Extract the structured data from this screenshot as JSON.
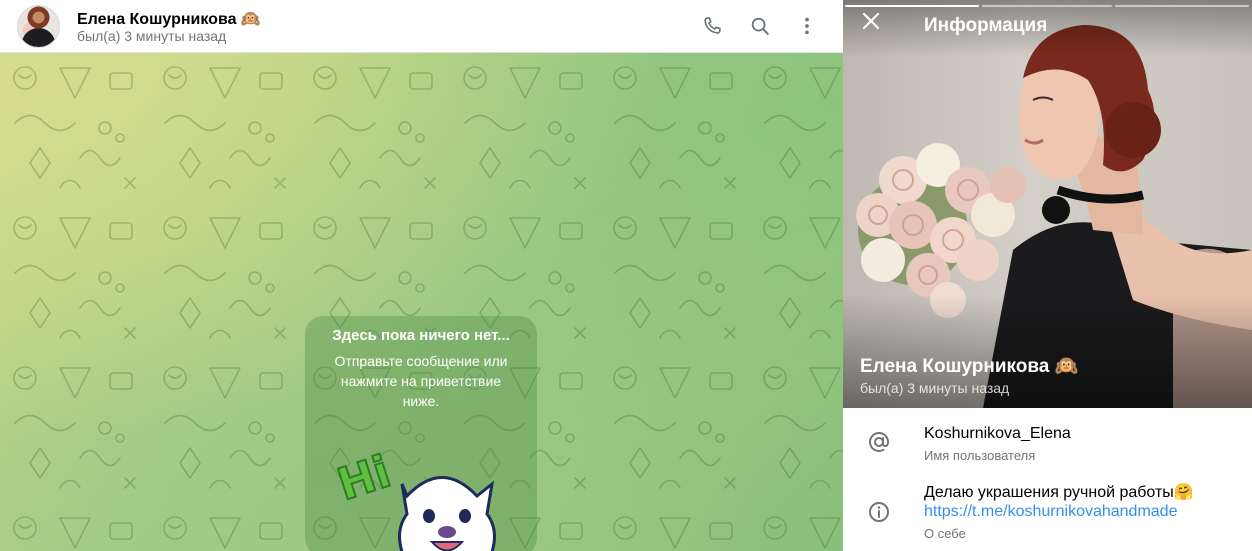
{
  "chat_header": {
    "name": "Елена Кошурникова 🙉",
    "status": "был(а) 3 минуты назад",
    "buttons": [
      {
        "icon": "phone-icon"
      },
      {
        "icon": "search-icon"
      },
      {
        "icon": "more-vertical-icon"
      }
    ]
  },
  "chat_empty": {
    "title": "Здесь пока ничего нет...",
    "subtitle": "Отправьте сообщение или нажмите на приветствие ниже.",
    "sticker_text": "Hi",
    "sticker_icon": "hi-bear-sticker"
  },
  "info_panel": {
    "title": "Информация",
    "close_icon": "close-icon",
    "name": "Елена Кошурникова 🙉",
    "status": "был(а) 3 минуты назад",
    "photo_count": 3,
    "photo_active": 1,
    "username": {
      "value": "Koshurnikova_Elena",
      "label": "Имя пользователя",
      "icon": "at-icon"
    },
    "bio": {
      "text": "Делаю украшения ручной работы🤗",
      "link": "https://t.me/koshurnikovahandmade",
      "label": "О себе",
      "icon": "info-icon"
    }
  },
  "colors": {
    "accent": "#3390ec",
    "secondary_text": "#707579",
    "chat_bg_start": "#d6dd8c",
    "chat_bg_end": "#88bf7c"
  }
}
